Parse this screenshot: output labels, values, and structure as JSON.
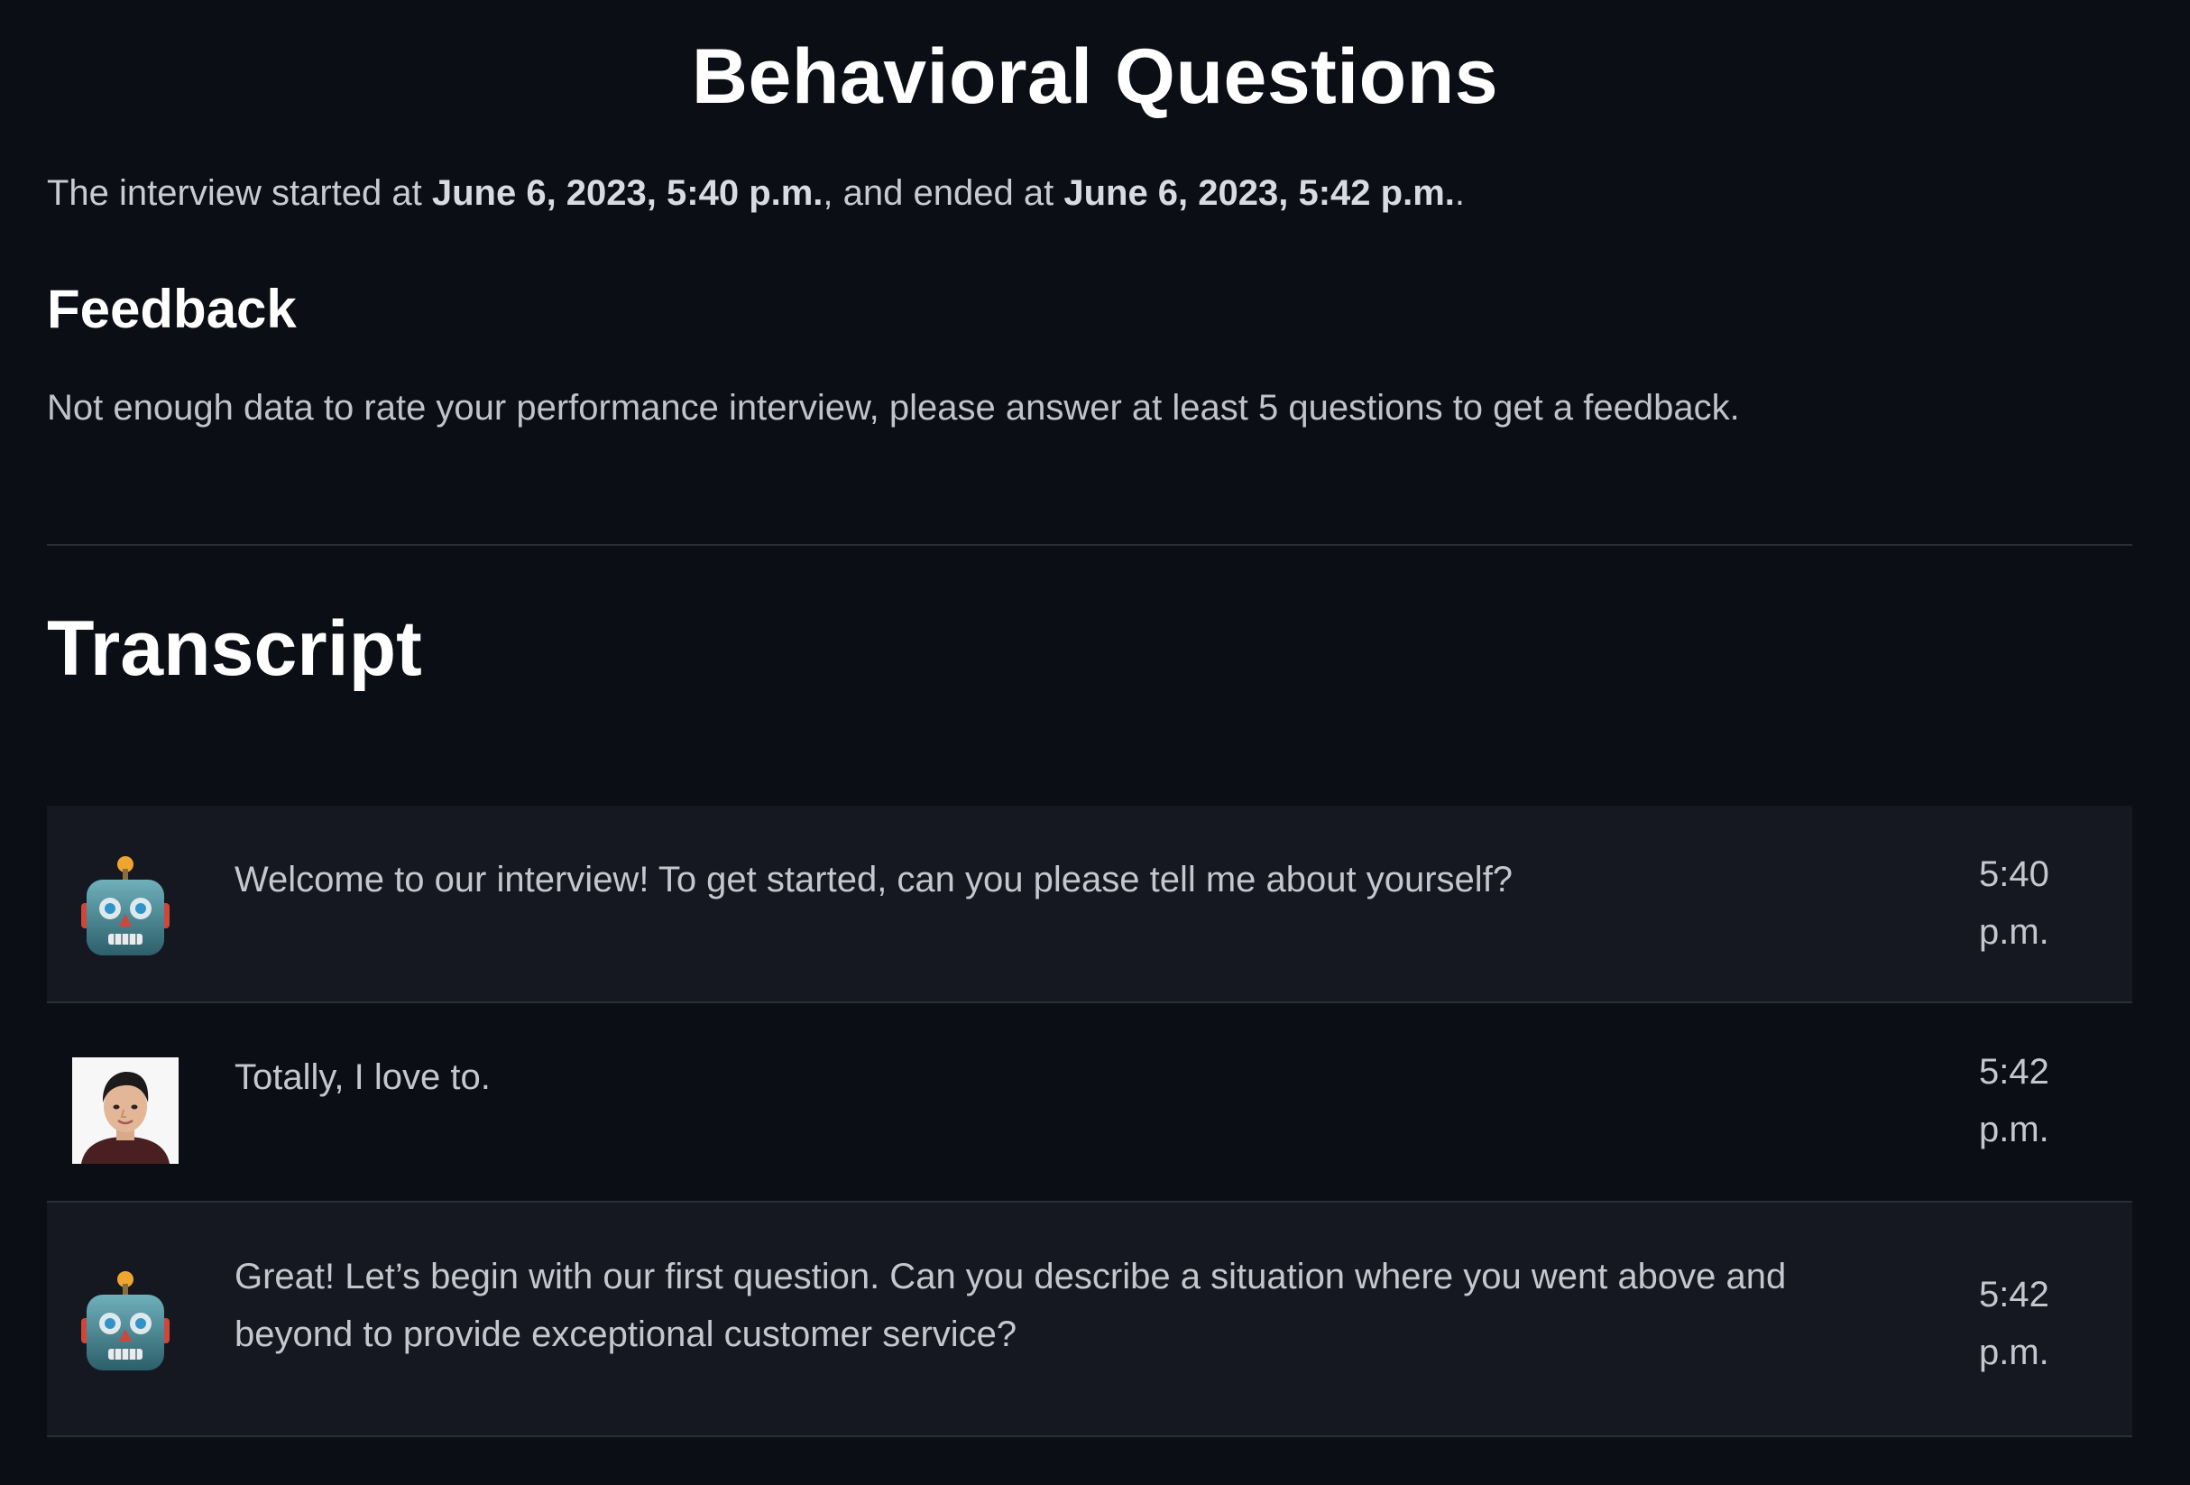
{
  "page": {
    "title": "Behavioral Questions"
  },
  "interview": {
    "prefix": "The interview started at ",
    "start": "June 6, 2023, 5:40 p.m.",
    "middle": ", and ended at ",
    "end": "June 6, 2023, 5:42 p.m.",
    "suffix": "."
  },
  "feedback": {
    "heading": "Feedback",
    "text": "Not enough data to rate your performance interview, please answer at least 5 questions to get a feedback."
  },
  "transcript": {
    "heading": "Transcript",
    "messages": [
      {
        "speaker": "bot",
        "avatar_icon": "robot-icon",
        "text": "Welcome to our interview! To get started, can you please tell me about yourself?",
        "time": "5:40 p.m."
      },
      {
        "speaker": "user",
        "avatar_icon": "user-photo",
        "text": "Totally, I love to.",
        "time": "5:42 p.m."
      },
      {
        "speaker": "bot",
        "avatar_icon": "robot-icon",
        "text": "Great! Let’s begin with our first question. Can you describe a situation where you went above and beyond to provide exceptional customer service?",
        "time": "5:42 p.m."
      }
    ]
  }
}
